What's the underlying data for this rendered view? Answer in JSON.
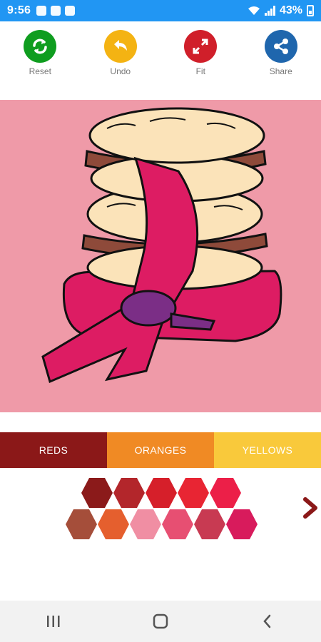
{
  "status_bar": {
    "time": "9:56",
    "battery": "43%",
    "background": "#2196f3"
  },
  "toolbar": {
    "buttons": [
      {
        "label": "Reset",
        "icon": "refresh-icon",
        "color": "#0f9d1f"
      },
      {
        "label": "Undo",
        "icon": "undo-icon",
        "color": "#f4b313"
      },
      {
        "label": "Fit",
        "icon": "expand-icon",
        "color": "#d01f2a"
      },
      {
        "label": "Share",
        "icon": "share-icon",
        "color": "#1f66ad"
      }
    ]
  },
  "canvas": {
    "background": "#ef9aa8",
    "picture": "macaron stack with ribbon coloring page"
  },
  "tabs": [
    {
      "label": "REDS",
      "color": "#8b1818",
      "selected": true
    },
    {
      "label": "ORANGES",
      "color": "#f08a24",
      "selected": false
    },
    {
      "label": "YELLOWS",
      "color": "#f9c93b",
      "selected": false
    }
  ],
  "palette": {
    "row1": [
      "#8b1a1a",
      "#b3262b",
      "#d61f2a",
      "#e82533",
      "#ec1f48"
    ],
    "row2": [
      "#a54e3a",
      "#e55f2e",
      "#f08ea3",
      "#e74f72",
      "#c83a52",
      "#d81b5c"
    ],
    "next_icon": "chevron-right-icon"
  },
  "nav_bar": {
    "icons": [
      "recent-apps-icon",
      "home-icon",
      "back-icon"
    ]
  }
}
